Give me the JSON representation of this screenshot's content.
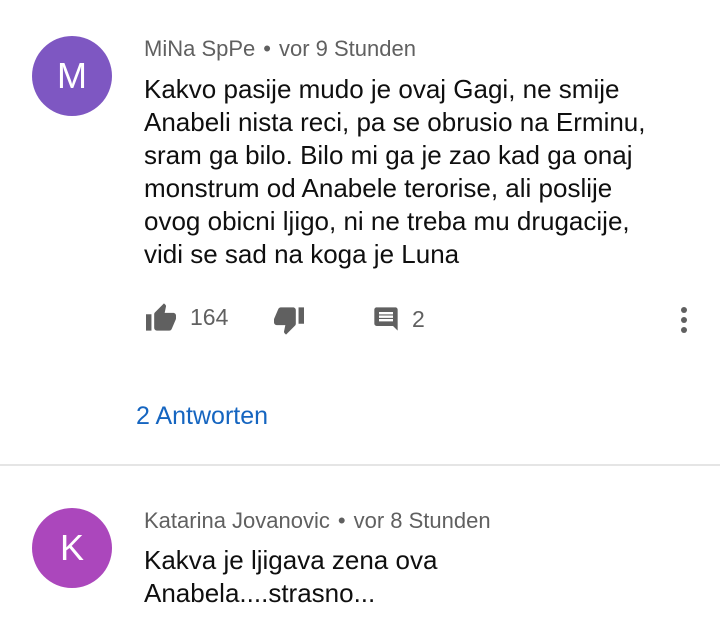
{
  "comments": [
    {
      "avatar_letter": "M",
      "avatar_color": "#7e57c2",
      "author": "MiNa SpPe",
      "separator": "•",
      "time": "vor 9 Stunden",
      "lines": [
        "Kakvo pasije mudo je ovaj Gagi, ne smije",
        "Anabeli nista reci, pa se obrusio na Erminu,",
        "sram ga bilo. Bilo mi ga je zao kad ga onaj",
        "monstrum od Anabele terorise, ali poslije",
        "ovog obicni ljigo, ni ne treba mu drugacije,",
        "vidi se sad na koga je Luna"
      ],
      "like_count": "164",
      "reply_count": "2",
      "replies_link": "2 Antworten"
    },
    {
      "avatar_letter": "K",
      "avatar_color": "#ab47bc",
      "author": "Katarina Jovanovic",
      "separator": "•",
      "time": "vor 8 Stunden",
      "lines": [
        "Kakva je ljigava zena ova",
        "Anabela....strasno..."
      ]
    }
  ],
  "icons": {
    "like": "thumb-up-icon",
    "dislike": "thumb-down-icon",
    "reply": "comment-icon",
    "more": "more-vert-icon"
  }
}
